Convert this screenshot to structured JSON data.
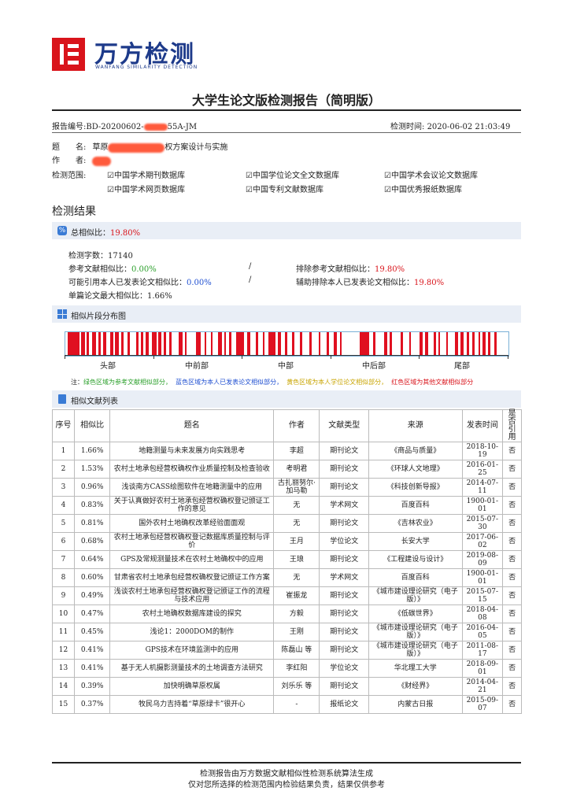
{
  "header": {
    "logo_text": "万方检测",
    "logo_sub": "WANFANG SIMILARITY DETECTION",
    "title": "大学生论文版检测报告（简明版）"
  },
  "meta": {
    "report_no_label": "报告编号:",
    "report_no_prefix": "BD-20200602-",
    "report_no_suffix": "55A-JM",
    "check_time_label": "检测时间:",
    "check_time": "2020-06-02 21:03:49",
    "title_label": "题　　名:",
    "title_visible_prefix": "草原",
    "title_visible_suffix": "权方案设计与实施",
    "author_label": "作　　者:",
    "scope_label": "检测范围:",
    "scope_items": [
      "☑中国学术期刊数据库",
      "☑中国学位论文全文数据库",
      "☑中国学术会议论文数据库",
      "☑中国学术网页数据库",
      "☑中国专利文献数据库",
      "☑中国优秀报纸数据库"
    ]
  },
  "results": {
    "section_title": "检测结果",
    "total_label": "总相似比：",
    "total_value": "19.80%",
    "words_label": "检测字数：",
    "words_value": "17140",
    "ref_label": "参考文献相似比：",
    "ref_value": "0.00%",
    "excl_ref_label": "排除参考文献相似比：",
    "excl_ref_value": "19.80%",
    "self_label": "可能引用本人已发表论文相似比：",
    "self_value": "0.00%",
    "excl_self_label": "辅助排除本人已发表论文相似比：",
    "excl_self_value": "19.80%",
    "max_label": "单篇论文最大相似比：",
    "max_value": "1.66%",
    "slash": "/"
  },
  "distribution": {
    "title": "相似片段分布图",
    "axis_labels": [
      "头部",
      "中前部",
      "中部",
      "中后部",
      "尾部"
    ],
    "note_prefix": "注：",
    "note_green": "绿色区域为参考文献相似部分，",
    "note_blue": "蓝色区域为本人已发表论文相似部分，",
    "note_yellow": "黄色区域为本人学位论文相似部分，",
    "note_red": "红色区域为其他文献相似部分",
    "segments": [
      [
        0.6,
        3.2
      ],
      [
        3.6,
        4.4
      ],
      [
        4.8,
        5.4
      ],
      [
        6.0,
        7.0
      ],
      [
        7.4,
        8.0
      ],
      [
        8.6,
        9.2
      ],
      [
        10.2,
        10.8
      ],
      [
        11.2,
        12.0
      ],
      [
        12.6,
        13.2
      ],
      [
        14.0,
        14.6
      ],
      [
        16.0,
        16.5
      ],
      [
        17.0,
        17.6
      ],
      [
        18.2,
        18.8
      ],
      [
        19.6,
        20.6
      ],
      [
        21.0,
        21.6
      ],
      [
        22.2,
        22.8
      ],
      [
        23.4,
        23.9
      ],
      [
        25.6,
        26.4
      ],
      [
        27.0,
        27.4
      ],
      [
        29.4,
        30.6
      ],
      [
        31.4,
        31.8
      ],
      [
        32.8,
        33.3
      ],
      [
        34.4,
        35.4
      ],
      [
        35.8,
        36.2
      ],
      [
        37.0,
        37.4
      ],
      [
        38.6,
        40.4
      ],
      [
        41.0,
        41.8
      ],
      [
        43.0,
        43.6
      ],
      [
        44.6,
        45.0
      ],
      [
        45.8,
        47.4
      ],
      [
        48.0,
        48.6
      ],
      [
        49.6,
        50.1
      ],
      [
        51.2,
        51.6
      ],
      [
        53.0,
        53.4
      ],
      [
        55.0,
        55.6
      ],
      [
        57.2,
        57.6
      ],
      [
        59.0,
        59.5
      ],
      [
        60.6,
        61.2
      ],
      [
        62.0,
        62.4
      ],
      [
        66.4,
        68.6
      ],
      [
        69.4,
        69.9
      ],
      [
        72.0,
        72.6
      ],
      [
        73.2,
        73.8
      ],
      [
        75.6,
        76.2
      ],
      [
        77.6,
        78.0
      ],
      [
        80.0,
        80.6
      ],
      [
        81.2,
        81.8
      ],
      [
        83.2,
        83.6
      ],
      [
        84.2,
        84.6
      ],
      [
        86.0,
        86.4
      ],
      [
        88.0,
        88.6
      ],
      [
        89.2,
        89.8
      ],
      [
        90.6,
        91.2
      ],
      [
        91.8,
        92.4
      ],
      [
        93.2,
        93.6
      ],
      [
        94.2,
        94.8
      ],
      [
        95.4,
        96.0
      ],
      [
        96.8,
        97.4
      ]
    ]
  },
  "literature": {
    "title": "相似文献列表",
    "columns": [
      "序号",
      "相似比",
      "题名",
      "作者",
      "文献类型",
      "来源",
      "发表时间",
      "是否引用"
    ],
    "rows": [
      [
        "1",
        "1.66%",
        "地籍测量与未来发展方向实践思考",
        "李超",
        "期刊论文",
        "《商品与质量》",
        "2018-10-19",
        "否"
      ],
      [
        "2",
        "1.53%",
        "农村土地承包经营权确权作业质量控制及检查验收",
        "考明君",
        "期刊论文",
        "《环球人文地理》",
        "2016-01-25",
        "否"
      ],
      [
        "3",
        "0.96%",
        "浅谈南方CASS绘图软件在地籍测量中的应用",
        "古扎丽努尔·加马勒",
        "期刊论文",
        "《科技创新导报》",
        "2014-07-11",
        "否"
      ],
      [
        "4",
        "0.83%",
        "关于认真做好农村土地承包经营权确权登记颁证工作的意见",
        "无",
        "学术网文",
        "百度百科",
        "1900-01-01",
        "否"
      ],
      [
        "5",
        "0.81%",
        "国外农村土地确权改革经验面面观",
        "无",
        "期刊论文",
        "《吉林农业》",
        "2015-07-30",
        "否"
      ],
      [
        "6",
        "0.68%",
        "农村土地承包经营权确权登记数据库质量控制与评价",
        "王月",
        "学位论文",
        "长安大学",
        "2017-06-02",
        "否"
      ],
      [
        "7",
        "0.64%",
        "GPS及常规测量技术在农村土地确权中的应用",
        "王琅",
        "期刊论文",
        "《工程建设与设计》",
        "2019-08-09",
        "否"
      ],
      [
        "8",
        "0.60%",
        "甘肃省农村土地承包经营权确权登记颁证工作方案",
        "无",
        "学术网文",
        "百度百科",
        "1900-01-01",
        "否"
      ],
      [
        "9",
        "0.49%",
        "浅谈农村土地承包经营权确权登记颁证工作的流程与技术应用",
        "崔振龙",
        "期刊论文",
        "《城市建设理论研究（电子版）》",
        "2015-07-15",
        "否"
      ],
      [
        "10",
        "0.47%",
        "农村土地确权数据库建设的探究",
        "方毅",
        "期刊论文",
        "《低碳世界》",
        "2018-04-08",
        "否"
      ],
      [
        "11",
        "0.45%",
        "浅论1：2000DOM的制作",
        "王刚",
        "期刊论文",
        "《城市建设理论研究（电子版）》",
        "2016-04-05",
        "否"
      ],
      [
        "12",
        "0.41%",
        "GPS技术在环境监测中的应用",
        "陈磊山 等",
        "期刊论文",
        "《城市建设理论研究（电子版）》",
        "2011-08-17",
        "否"
      ],
      [
        "13",
        "0.41%",
        "基于无人机摄影测量技术的土地调查方法研究",
        "李红阳",
        "学位论文",
        "华北理工大学",
        "2018-09-01",
        "否"
      ],
      [
        "14",
        "0.39%",
        "加快明确草原权属",
        "刘乐乐 等",
        "期刊论文",
        "《财经界》",
        "2014-04-21",
        "否"
      ],
      [
        "15",
        "0.37%",
        "牧民乌力吉持着“草原绿卡”很开心",
        "-",
        "报纸论文",
        "内蒙古日报",
        "2015-09-07",
        "否"
      ]
    ]
  },
  "footer": {
    "line1": "检测报告由万方数据文献相似性检测系统算法生成",
    "line2": "仅对您所选择的检测范围内检验结果负责，结果仅供参考"
  },
  "colors": {
    "red": "#d9141b",
    "brand_blue": "#1d3a8a",
    "band": "#e9eef6"
  }
}
